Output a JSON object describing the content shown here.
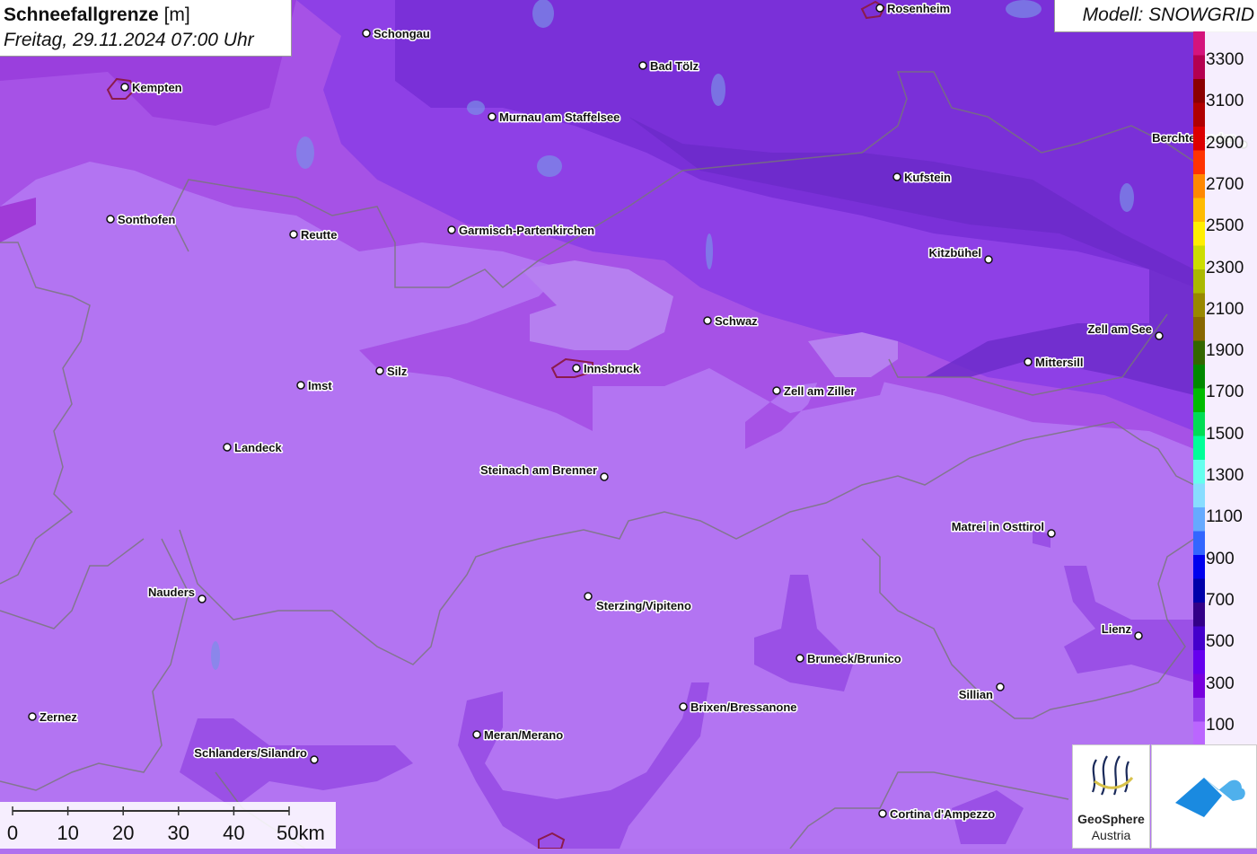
{
  "header": {
    "title_bold": "Schneefallgrenze",
    "title_unit": " [m]",
    "subtitle": "Freitag, 29.11.2024 07:00 Uhr"
  },
  "model": {
    "label": "Modell: SNOWGRID"
  },
  "legend": {
    "labels": [
      "3300",
      "3100",
      "2900",
      "2700",
      "2500",
      "2300",
      "2100",
      "1900",
      "1700",
      "1500",
      "1300",
      "1100",
      "900",
      "700",
      "500",
      "300",
      "100"
    ],
    "colors": [
      "#d4147c",
      "#b40050",
      "#8b0000",
      "#b00000",
      "#dc0000",
      "#ff3300",
      "#ff8800",
      "#ffbb00",
      "#ffee00",
      "#ccdd00",
      "#aab800",
      "#998800",
      "#886600",
      "#336600",
      "#008800",
      "#00bb00",
      "#00dd55",
      "#00ff99",
      "#66ffee",
      "#88ddff",
      "#66aaff",
      "#3366ff",
      "#0000ee",
      "#0000aa",
      "#330088",
      "#4400cc",
      "#6600ee",
      "#7700dd",
      "#9944ee",
      "#bb66ff"
    ]
  },
  "cities": [
    {
      "name": "Rosenheim"
    },
    {
      "name": "Schongau"
    },
    {
      "name": "Bad Tölz"
    },
    {
      "name": "Kempten"
    },
    {
      "name": "Murnau am Staffelsee"
    },
    {
      "name": "Berchtesgaden"
    },
    {
      "name": "Kufstein"
    },
    {
      "name": "Sonthofen"
    },
    {
      "name": "Reutte"
    },
    {
      "name": "Garmisch-Partenkirchen"
    },
    {
      "name": "Kitzbühel"
    },
    {
      "name": "Schwaz"
    },
    {
      "name": "Zell am See"
    },
    {
      "name": "Mittersill"
    },
    {
      "name": "Silz"
    },
    {
      "name": "Innsbruck"
    },
    {
      "name": "Imst"
    },
    {
      "name": "Zell am Ziller"
    },
    {
      "name": "Landeck"
    },
    {
      "name": "Steinach am Brenner"
    },
    {
      "name": "Matrei in Osttirol"
    },
    {
      "name": "Nauders"
    },
    {
      "name": "Sterzing/Vipiteno"
    },
    {
      "name": "Lienz"
    },
    {
      "name": "Bruneck/Brunico"
    },
    {
      "name": "Sillian"
    },
    {
      "name": "Brixen/Bressanone"
    },
    {
      "name": "Zernez"
    },
    {
      "name": "Meran/Merano"
    },
    {
      "name": "Schlanders/Silandro"
    },
    {
      "name": "Cortina d'Ampezzo"
    }
  ],
  "scale": {
    "ticks": [
      "0",
      "10",
      "20",
      "30",
      "40",
      "50km"
    ]
  },
  "logos": {
    "geosphere_line1": "GeoSphere",
    "geosphere_line2": "Austria"
  }
}
